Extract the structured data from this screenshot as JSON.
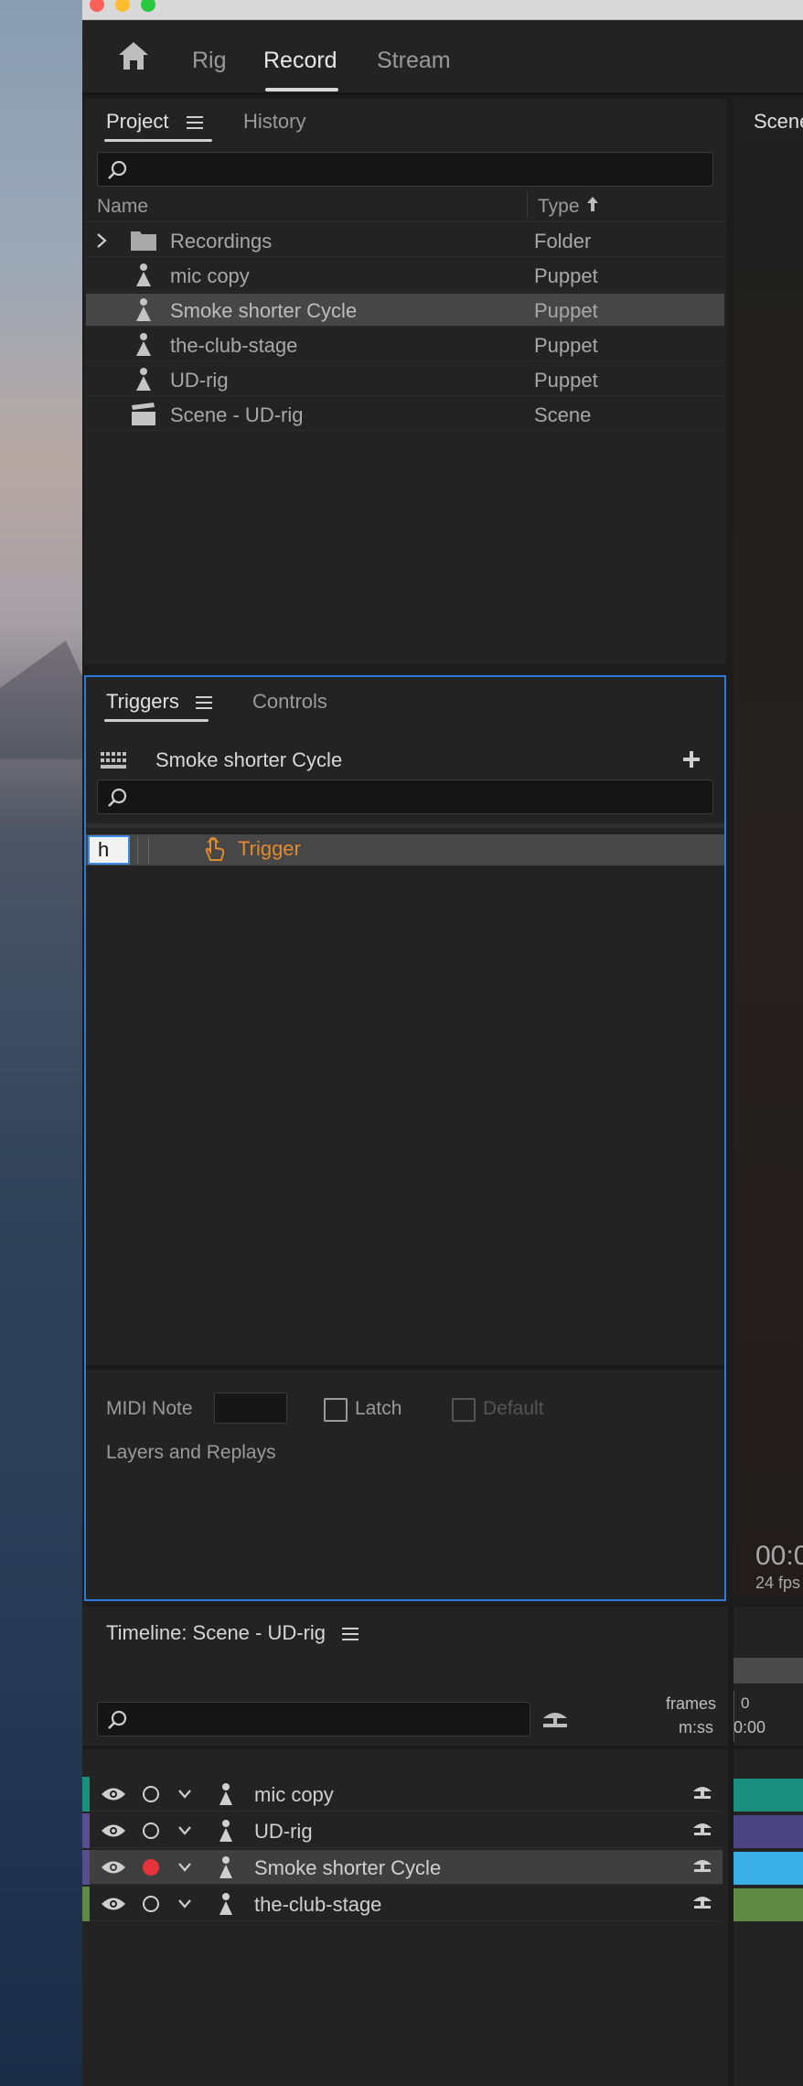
{
  "workspace": {
    "tabs": [
      "Rig",
      "Record",
      "Stream"
    ],
    "active_tab": "Record"
  },
  "project_panel": {
    "tabs": [
      "Project",
      "History"
    ],
    "search_placeholder": "",
    "columns": {
      "name": "Name",
      "type": "Type"
    },
    "rows": [
      {
        "name": "Recordings",
        "type": "Folder",
        "icon": "folder-icon"
      },
      {
        "name": "mic copy",
        "type": "Puppet",
        "icon": "puppet-icon"
      },
      {
        "name": "Smoke shorter Cycle",
        "type": "Puppet",
        "icon": "puppet-icon",
        "selected": true
      },
      {
        "name": "the-club-stage",
        "type": "Puppet",
        "icon": "puppet-icon"
      },
      {
        "name": "UD-rig",
        "type": "Puppet",
        "icon": "puppet-icon"
      },
      {
        "name": "Scene - UD-rig",
        "type": "Scene",
        "icon": "scene-icon"
      }
    ]
  },
  "triggers_panel": {
    "tabs": [
      "Triggers",
      "Controls"
    ],
    "puppet_name": "Smoke shorter Cycle",
    "search_placeholder": "",
    "trigger": {
      "key": "h",
      "label": "Trigger"
    },
    "midi_note_label": "MIDI Note",
    "latch_label": "Latch",
    "default_label": "Default",
    "layers_label": "Layers and Replays"
  },
  "scene_panel": {
    "tab": "Scene",
    "time": "00:0",
    "fps": "24 fps"
  },
  "timeline": {
    "title": "Timeline: Scene - UD-rig",
    "frames_label": "frames",
    "mss_label": "m:ss",
    "frames_value": "0",
    "mss_value": "0:00",
    "rows": [
      {
        "label": "mic copy",
        "color": "#1a8f7e",
        "track": "#1a8f7e",
        "armed": false
      },
      {
        "label": "UD-rig",
        "color": "#5a4d8f",
        "track": "#4c4583",
        "armed": false
      },
      {
        "label": "Smoke shorter Cycle",
        "color": "#5a4d8f",
        "track": "#3aaee6",
        "armed": true
      },
      {
        "label": "the-club-stage",
        "color": "#5e8a45",
        "track": "#5e8a45",
        "armed": false
      }
    ]
  }
}
